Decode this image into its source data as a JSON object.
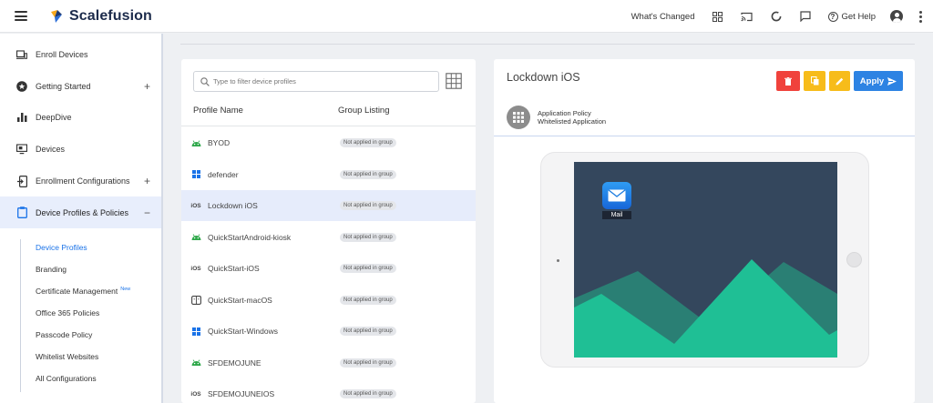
{
  "app": {
    "brand": "Scalefusion"
  },
  "topbar": {
    "whats_changed": "What's Changed",
    "get_help": "Get Help",
    "icons": [
      "apps-grid-icon",
      "cast-icon",
      "loading-ring-icon",
      "chat-icon",
      "help-circle-icon",
      "account-icon",
      "more-vert-icon"
    ]
  },
  "sidebar": {
    "items": [
      {
        "label": "Enroll Devices",
        "icon": "devices-icon",
        "expandable": false
      },
      {
        "label": "Getting Started",
        "icon": "star-circle-icon",
        "expandable": true
      },
      {
        "label": "DeepDive",
        "icon": "bar-chart-icon",
        "expandable": false
      },
      {
        "label": "Devices",
        "icon": "monitor-icon",
        "expandable": false
      },
      {
        "label": "Enrollment Configurations",
        "icon": "enroll-config-icon",
        "expandable": true
      },
      {
        "label": "Device Profiles & Policies",
        "icon": "clipboard-icon",
        "expandable": true,
        "expanded": true
      }
    ],
    "expand_symbol": "+",
    "collapse_symbol": "−",
    "subitems": [
      {
        "label": "Device Profiles",
        "active": true
      },
      {
        "label": "Branding"
      },
      {
        "label": "Certificate Management",
        "badge": "New"
      },
      {
        "label": "Office 365 Policies"
      },
      {
        "label": "Passcode Policy"
      },
      {
        "label": "Whitelist Websites"
      },
      {
        "label": "All Configurations"
      }
    ]
  },
  "profiles_panel": {
    "search_placeholder": "Type to filter device profiles",
    "col_name": "Profile Name",
    "col_group": "Group Listing",
    "rows": [
      {
        "platform": "android",
        "name": "BYOD",
        "group": "Not applied in group"
      },
      {
        "platform": "windows",
        "name": "defender",
        "group": "Not applied in group"
      },
      {
        "platform": "ios",
        "name": "Lockdown iOS",
        "group": "Not applied in group",
        "selected": true
      },
      {
        "platform": "android",
        "name": "QuickStartAndroid-kiosk",
        "group": "Not applied in group"
      },
      {
        "platform": "ios",
        "name": "QuickStart-iOS",
        "group": "Not applied in group"
      },
      {
        "platform": "macos",
        "name": "QuickStart-macOS",
        "group": "Not applied in group"
      },
      {
        "platform": "windows",
        "name": "QuickStart-Windows",
        "group": "Not applied in group"
      },
      {
        "platform": "android",
        "name": "SFDEMOJUNE",
        "group": "Not applied in group"
      },
      {
        "platform": "ios",
        "name": "SFDEMOJUNEIOS",
        "group": "Not applied in group"
      }
    ],
    "ios_label": "iOS"
  },
  "detail_panel": {
    "title": "Lockdown iOS",
    "apply_label": "Apply",
    "policy_line1": "Application Policy",
    "policy_line2": "Whitelisted Application",
    "app_name": "Mail",
    "colors": {
      "delete": "#f0423c",
      "copy": "#f7bc1a",
      "edit": "#f7bc1a",
      "apply": "#2d83e3"
    }
  }
}
